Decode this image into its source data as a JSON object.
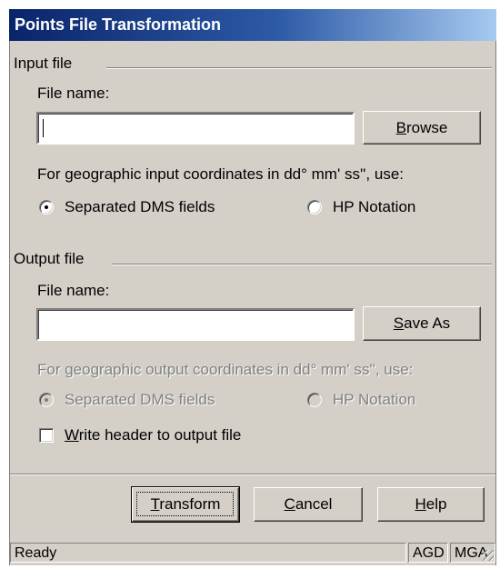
{
  "window": {
    "title": "Points File Transformation"
  },
  "input_group": {
    "label": "Input file",
    "file_name_label": "File name:",
    "file_name_value": "",
    "browse_prefix": "",
    "browse_mnemonic": "B",
    "browse_rest": "rowse",
    "coord_prompt": "For geographic input coordinates in dd° mm' ss'', use:",
    "options": [
      "Separated DMS fields",
      "HP Notation"
    ],
    "selected": "Separated DMS fields"
  },
  "output_group": {
    "label": "Output file",
    "file_name_label": "File name:",
    "file_name_value": "",
    "saveas_mnemonic": "S",
    "saveas_rest": "ave As",
    "coord_prompt": "For geographic output coordinates in dd° mm' ss'', use:",
    "options": [
      "Separated DMS fields",
      "HP Notation"
    ],
    "selected": "Separated DMS fields",
    "options_disabled": true,
    "header_check_mnemonic": "W",
    "header_check_rest": "rite header to output file",
    "header_checked": false
  },
  "buttons": {
    "transform_mnemonic": "T",
    "transform_rest": "ransform",
    "cancel_mnemonic": "C",
    "cancel_rest": "ancel",
    "help_mnemonic": "H",
    "help_rest": "elp"
  },
  "status_bar": {
    "message": "Ready",
    "datum": "AGD",
    "grid": "MGA"
  }
}
